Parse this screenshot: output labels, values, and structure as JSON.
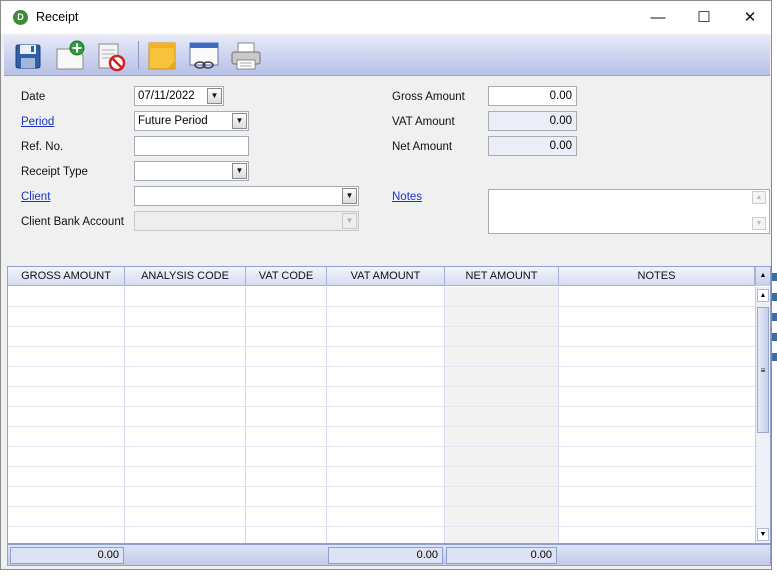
{
  "window": {
    "title": "Receipt",
    "minimize": "—",
    "maximize": "☐",
    "close": "✕",
    "app_icon_letter": "D"
  },
  "toolbar": {
    "buttons": [
      {
        "name": "save-icon"
      },
      {
        "name": "new-document-icon"
      },
      {
        "name": "delete-document-icon"
      },
      {
        "name": "sticky-note-icon"
      },
      {
        "name": "link-window-icon"
      },
      {
        "name": "print-icon"
      }
    ]
  },
  "form": {
    "date": {
      "label": "Date",
      "value": "07/11/2022"
    },
    "period": {
      "label": "Period",
      "value": "Future Period"
    },
    "ref_no": {
      "label": "Ref. No.",
      "value": ""
    },
    "receipt_type": {
      "label": "Receipt Type",
      "value": ""
    },
    "client": {
      "label": "Client",
      "value": ""
    },
    "client_bank_account": {
      "label": "Client Bank Account",
      "value": ""
    },
    "gross_amount": {
      "label": "Gross Amount",
      "value": "0.00"
    },
    "vat_amount": {
      "label": "VAT Amount",
      "value": "0.00"
    },
    "net_amount": {
      "label": "Net Amount",
      "value": "0.00"
    },
    "notes": {
      "label": "Notes",
      "value": ""
    }
  },
  "grid": {
    "columns": [
      "GROSS AMOUNT",
      "ANALYSIS CODE",
      "VAT CODE",
      "VAT AMOUNT",
      "NET AMOUNT",
      "NOTES"
    ],
    "rows": []
  },
  "footer": {
    "gross_total": "0.00",
    "vat_total": "0.00",
    "net_total": "0.00"
  },
  "colors": {
    "toolbar": "#c9d0ee",
    "link": "#1a33c8",
    "grid_border": "#8fa0cf"
  }
}
